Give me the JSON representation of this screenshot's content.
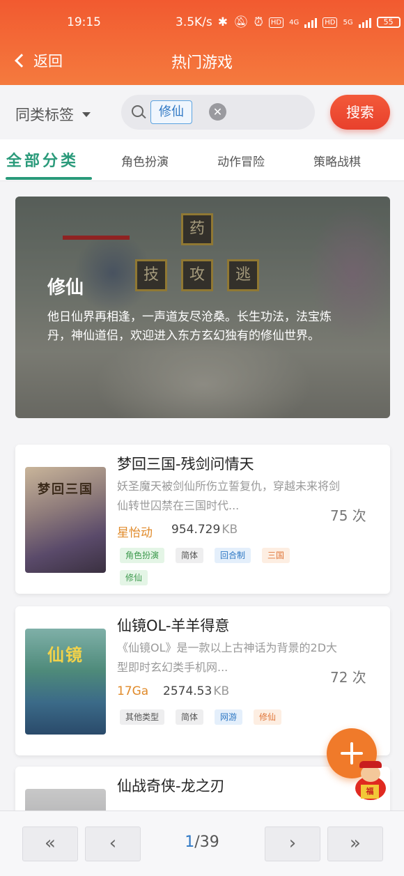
{
  "status": {
    "time": "19:15",
    "speed": "3.5K/s",
    "network_1": "4G",
    "network_2": "5G",
    "battery": "55"
  },
  "header": {
    "back_label": "返回",
    "title": "热门游戏"
  },
  "filter": {
    "label": "同类标签",
    "chip": "修仙",
    "search_label": "搜索"
  },
  "tabs": [
    {
      "label": "全部分类"
    },
    {
      "label": "角色扮演"
    },
    {
      "label": "动作冒险"
    },
    {
      "label": "策略战棋"
    }
  ],
  "banner": {
    "title": "修仙",
    "description": "他日仙界再相逢，一声道友尽沧桑。长生功法，法宝炼丹，神仙道侣，欢迎进入东方玄幻独有的修仙世界。",
    "tiles": [
      "药",
      "技",
      "攻",
      "逃"
    ]
  },
  "games": [
    {
      "title": "梦回三国-残剑问情天",
      "desc": "妖圣魔天被剑仙所伤立誓复仇，穿越未来将剑仙转世囚禁在三国时代...",
      "count": "75 次",
      "developer": "星怡动",
      "size_value": "954.729",
      "size_unit": "KB",
      "cover_caption": "梦回三国",
      "tags": [
        "角色扮演",
        "简体",
        "回合制",
        "三国",
        "修仙"
      ]
    },
    {
      "title": "仙镜OL-羊羊得意",
      "desc": "《仙镜OL》是一款以上古神话为背景的2D大型即时玄幻类手机网...",
      "count": "72 次",
      "developer": "17Ga",
      "size_value": "2574.53",
      "size_unit": "KB",
      "cover_caption": "仙镜",
      "tags": [
        "其他类型",
        "简体",
        "网游",
        "修仙"
      ]
    },
    {
      "title": "仙战奇侠-龙之刃"
    }
  ],
  "pager": {
    "first": "«",
    "prev": "‹",
    "current": "1",
    "total": "/39",
    "next": "›",
    "last": "»"
  },
  "mascot_text": "福",
  "colors": {
    "header": "#f25a30",
    "accent_tab": "#2a9a7a",
    "search_button": "#e8402c",
    "fab": "#f07a2a",
    "page_current": "#2f78c4"
  }
}
